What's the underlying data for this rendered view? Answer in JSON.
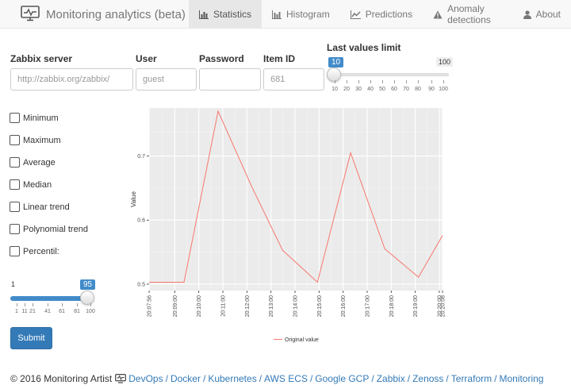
{
  "app": {
    "title": "Monitoring analytics (beta)"
  },
  "nav": {
    "tabs": [
      {
        "label": "Statistics",
        "icon": "bar-chart-icon",
        "active": true
      },
      {
        "label": "Histogram",
        "icon": "histogram-icon"
      },
      {
        "label": "Predictions",
        "icon": "line-chart-icon"
      },
      {
        "label": "Anomaly detections",
        "icon": "warning-icon"
      },
      {
        "label": "About",
        "icon": "user-icon"
      }
    ]
  },
  "form": {
    "server_label": "Zabbix server",
    "server_placeholder": "http://zabbix.org/zabbix/",
    "user_label": "User",
    "user_placeholder": "guest",
    "password_label": "Password",
    "password_value": "",
    "itemid_label": "Item ID",
    "itemid_placeholder": "681",
    "limit_label": "Last values limit",
    "limit_value": "10",
    "limit_max": "100",
    "limit_ticks": [
      "10",
      "20",
      "30",
      "40",
      "50",
      "60",
      "70",
      "80",
      "90",
      "100"
    ]
  },
  "options": [
    {
      "label": "Minimum",
      "checked": false
    },
    {
      "label": "Maximum",
      "checked": false
    },
    {
      "label": "Average",
      "checked": false
    },
    {
      "label": "Median",
      "checked": false
    },
    {
      "label": "Linear trend",
      "checked": false
    },
    {
      "label": "Polynomial trend",
      "checked": false
    },
    {
      "label": "Percentil:",
      "checked": false
    }
  ],
  "percentile": {
    "min": "1",
    "value": "95",
    "ticks": [
      "1",
      "11",
      "21",
      "41",
      "61",
      "81",
      "100"
    ]
  },
  "submit_label": "Submit",
  "footer": {
    "copyright": "© 2016 Monitoring Artist",
    "links": [
      "DevOps",
      "Docker",
      "Kubernetes",
      "AWS ECS",
      "Google GCP",
      "Zabbix",
      "Zenoss",
      "Terraform",
      "Monitoring"
    ]
  },
  "colors": {
    "line": "#f8766d",
    "panel": "#ebebeb",
    "accent": "#428bca",
    "button": "#337ab7"
  },
  "chart_data": {
    "type": "line",
    "ylabel": "Value",
    "xlabel": "",
    "x_tick_labels": [
      "20:07:56",
      "20:09:00",
      "20:10:00",
      "20:11:00",
      "20:12:00",
      "20:13:00",
      "20:14:00",
      "20:15:00",
      "20:16:00",
      "20:17:00",
      "20:18:00",
      "20:19:00",
      "20:20:00",
      "20:20:08"
    ],
    "x_tick_minutes": [
      0.0,
      1.067,
      2.067,
      3.067,
      4.067,
      5.067,
      6.067,
      7.067,
      8.067,
      9.067,
      10.067,
      11.067,
      12.067,
      12.2
    ],
    "y_ticks": [
      0.5,
      0.6,
      0.7
    ],
    "ylim": [
      0.49,
      0.775
    ],
    "xlim_minutes": [
      0.0,
      12.2
    ],
    "grid": true,
    "legend_position": "bottom",
    "series": [
      {
        "name": "Original value",
        "x_minutes": [
          0.0,
          1.45,
          2.87,
          4.27,
          5.55,
          7.0,
          8.38,
          9.8,
          11.2,
          12.2
        ],
        "values": [
          0.503,
          0.503,
          0.77,
          0.652,
          0.553,
          0.503,
          0.705,
          0.555,
          0.511,
          0.576
        ]
      }
    ]
  }
}
